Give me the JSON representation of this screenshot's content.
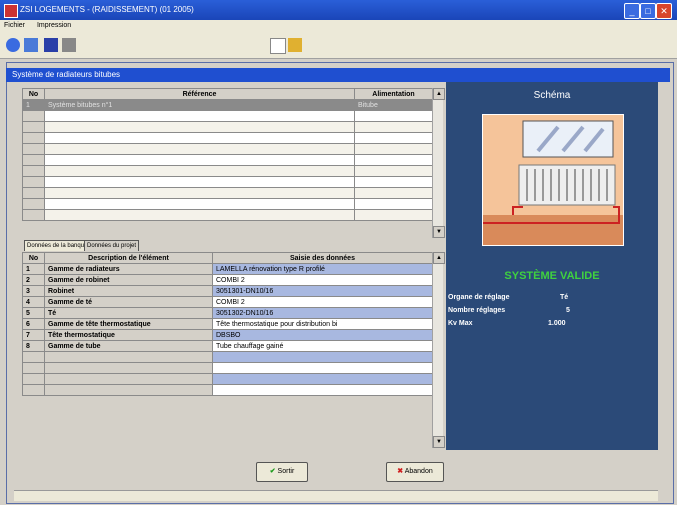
{
  "window": {
    "title": "ZSI LOGEMENTS - (RAIDISSEMENT) (01 2005)"
  },
  "menu": [
    "Fichier",
    "Impression"
  ],
  "panel": {
    "title": "Système de radiateurs bitubes"
  },
  "top_grid": {
    "headers": [
      "No",
      "Référence",
      "Alimentation"
    ],
    "rows": [
      {
        "no": "1",
        "reference": "Système bitubes n°1",
        "alimentation": "Bitube"
      }
    ]
  },
  "tabs": [
    "Données de la banque",
    "Données du projet"
  ],
  "bottom_grid": {
    "headers": [
      "No",
      "Description de l'élément",
      "Saisie des données"
    ],
    "rows": [
      {
        "no": "1",
        "desc": "Gamme de radiateurs",
        "value": "LAMELLA rénovation type R profilé"
      },
      {
        "no": "2",
        "desc": "Gamme de robinet",
        "value": "COMBI 2"
      },
      {
        "no": "3",
        "desc": "Robinet",
        "value": "3051301-DN10/16"
      },
      {
        "no": "4",
        "desc": "Gamme de té",
        "value": "COMBI 2"
      },
      {
        "no": "5",
        "desc": "Té",
        "value": "3051302-DN10/16"
      },
      {
        "no": "6",
        "desc": "Gamme de tête thermostatique",
        "value": "Tête thermostatique pour distribution bi"
      },
      {
        "no": "7",
        "desc": "Tête thermostatique",
        "value": "DBSBO"
      },
      {
        "no": "8",
        "desc": "Gamme de tube",
        "value": "Tube chauffage gainé"
      }
    ]
  },
  "right": {
    "schema_title": "Schéma",
    "status": "SYSTÈME VALIDE",
    "info": [
      {
        "label": "Organe de réglage",
        "value": "Té"
      },
      {
        "label": "Nombre réglages",
        "value": "5"
      },
      {
        "label": "Kv Max",
        "value": "1.000"
      }
    ]
  },
  "buttons": {
    "ok": "Sortir",
    "cancel": "Abandon"
  },
  "colors": {
    "title_bar": "#1a45b8",
    "header": "#1f4fd0",
    "panel": "#2b4a78",
    "valid": "#3fd13f",
    "row_blue": "#a8b8e0"
  }
}
